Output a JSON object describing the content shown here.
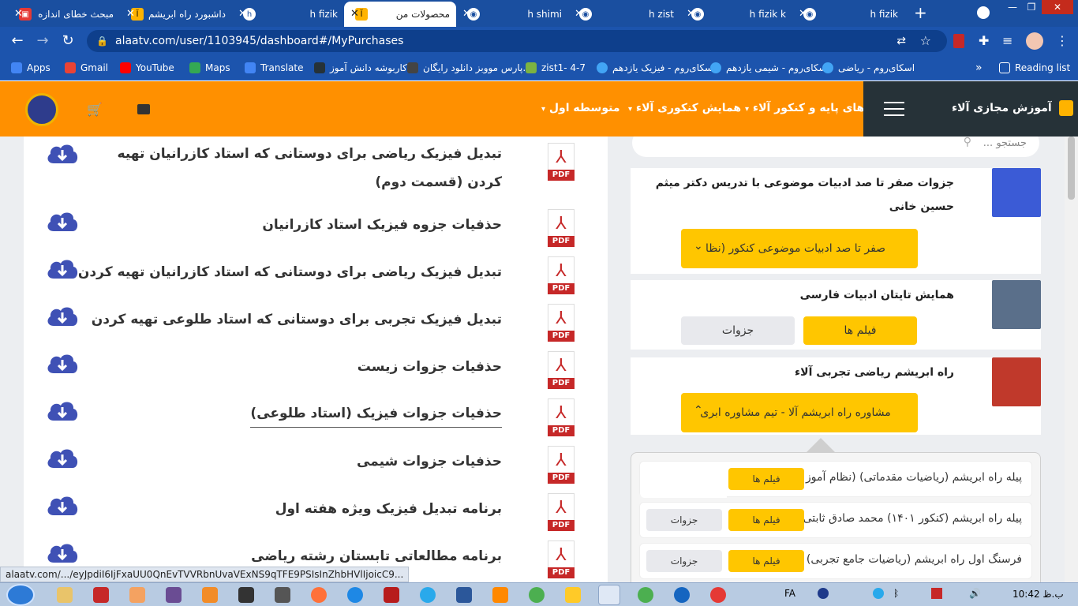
{
  "browser": {
    "tabs": [
      {
        "title": "مبحث خطای اندازه",
        "icon": "page-icon"
      },
      {
        "title": "داشبورد راه ابریشم",
        "icon": "alaa-icon"
      },
      {
        "title": "h fizik",
        "icon": "h-icon"
      },
      {
        "title": "محصولات من",
        "icon": "alaa-icon"
      },
      {
        "title": "h shimi",
        "icon": "globe-icon"
      },
      {
        "title": "h zist",
        "icon": "globe-icon"
      },
      {
        "title": "h fizik k",
        "icon": "globe-icon"
      },
      {
        "title": "h fizik",
        "icon": "globe-icon"
      }
    ],
    "new_tab": "+",
    "url": "alaatv.com/user/1103945/dashboard#/MyPurchases",
    "bookmarks": [
      {
        "label": "Apps",
        "color": "#4285f4"
      },
      {
        "label": "Gmail",
        "color": "#ea4335"
      },
      {
        "label": "YouTube",
        "color": "#ff0000"
      },
      {
        "label": "Maps",
        "color": "#34a853"
      },
      {
        "label": "Translate",
        "color": "#4285f4"
      },
      {
        "label": "کاربوشه دانش آموز",
        "color": "#263238"
      },
      {
        "label": "پارس مووبز دانلود رایگان...",
        "color": "#444444"
      },
      {
        "label": "zist1- 4-7",
        "color": "#7cb342"
      },
      {
        "label": "اسکای‌روم - فیزیک یازدهم",
        "color": "#42a5f5"
      },
      {
        "label": "اسکای‌روم - شیمی یازدهم",
        "color": "#42a5f5"
      },
      {
        "label": "اسکای‌روم - ریاضی",
        "color": "#42a5f5"
      }
    ],
    "more": "»",
    "reading_list": "Reading list"
  },
  "site": {
    "brand": "آموزش مجازی آلاء",
    "menu": [
      {
        "label": "فیلم های پایه و کنکور آلاء"
      },
      {
        "label": "همایش کنکوری آلاء"
      },
      {
        "label": "متوسطه اول"
      }
    ]
  },
  "purchases": [
    {
      "title": "تبدیل فیزیک ریاضی برای دوستانی که استاد کازرانیان تهیه کردن (قسمت دوم)",
      "pdf": "PDF"
    },
    {
      "title": "حذفیات جزوه فیزیک استاد کازرانیان",
      "pdf": "PDF"
    },
    {
      "title": "تبدیل فیزیک ریاضی برای دوستانی که استاد کازرانیان تهیه کردن",
      "pdf": "PDF"
    },
    {
      "title": "تبدیل فیزیک تجربی برای دوستانی که استاد طلوعی تهیه کردن",
      "pdf": "PDF"
    },
    {
      "title": "حذفیات جزوات زیست",
      "pdf": "PDF"
    },
    {
      "title": "حذفیات جزوات فیزیک (استاد طلوعی)",
      "pdf": "PDF"
    },
    {
      "title": "حذفیات جزوات شیمی",
      "pdf": "PDF"
    },
    {
      "title": "برنامه تبدیل فیزیک ویژه هفته اول",
      "pdf": "PDF"
    },
    {
      "title": "برنامه مطالعاتی تابستان رشته ریاضی",
      "pdf": "PDF"
    }
  ],
  "sidebar": {
    "search_placeholder": "جستجو ...",
    "cards": [
      {
        "title": "جزوات صفر تا صد ادبیات موضوعی با تدریس دکتر میثم حسین خانی",
        "dropdown": "صفر تا صد ادبیات موضوعی کنکور (نظا",
        "thumb_color": "#3b5bd6"
      },
      {
        "title": "همایش تایتان ادبیات فارسی",
        "films": "فیلم ها",
        "notes": "جزوات",
        "thumb_color": "#5a6f8a"
      },
      {
        "title": "راه ابریشم ریاضی تجربی آلاء",
        "dropdown": "مشاوره راه ابریشم آلا - تیم مشاوره ابری",
        "thumb_color": "#c0392b"
      }
    ],
    "sub_items": [
      {
        "title": "پیله راه ابریشم (ریاضیات مقدماتی) (نظام آموز",
        "films": "فیلم ها"
      },
      {
        "title": "پیله راه ابریشم (کنکور ۱۴۰۱) محمد صادق ثابتی",
        "films": "فیلم ها",
        "notes": "جزوات"
      },
      {
        "title": "فرسنگ اول راه ابریشم (ریاضیات جامع تجربی)",
        "films": "فیلم ها",
        "notes": "جزوات"
      }
    ]
  },
  "status_url": "alaatv.com/.../eyJpdiI6IjFxaUU0QnEvTVVRbnUvaVExNS9qTFE9PSIsInZhbHVlIjoicC9...",
  "taskbar": {
    "lang": "FA",
    "time": "10:42",
    "period": "ب.ظ"
  },
  "colors": {
    "brand_orange": "#ff9000",
    "accent_yellow": "#ffc600",
    "chrome_blue": "#1a4fa0",
    "download_blue": "#3f51b5",
    "pdf_red": "#c62828"
  }
}
